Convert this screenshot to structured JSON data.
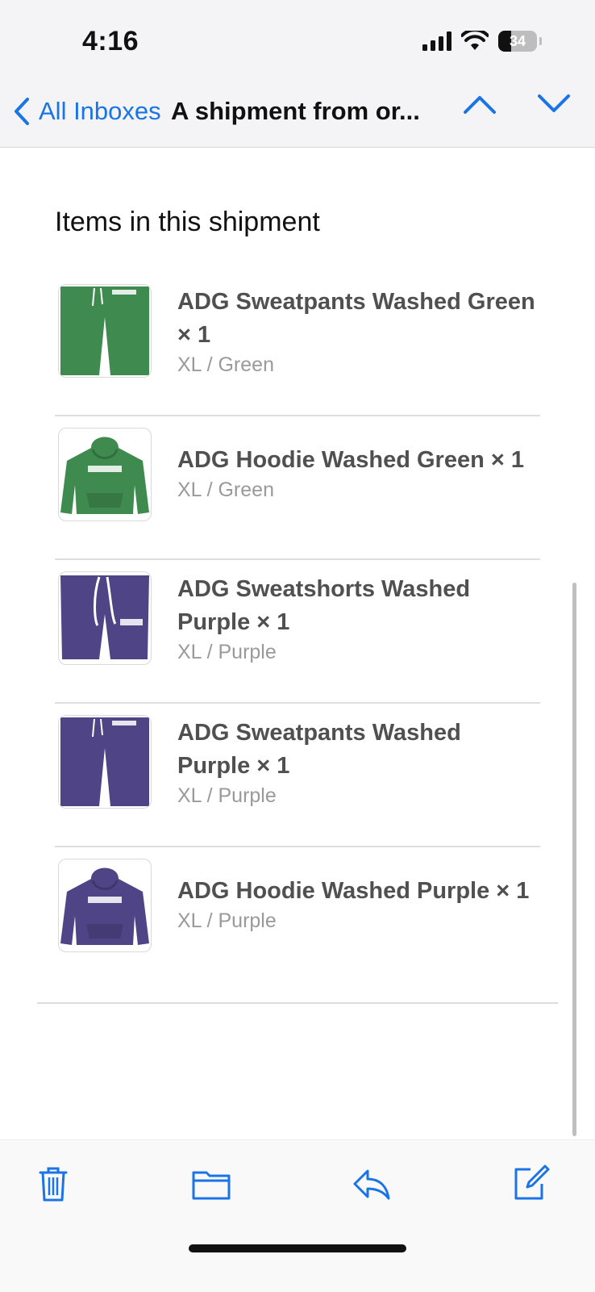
{
  "status": {
    "time": "4:16",
    "battery": "34",
    "battery_level": 0.34
  },
  "nav": {
    "back_label": "All Inboxes",
    "title": "A shipment from or..."
  },
  "section": {
    "title": "Items in this shipment"
  },
  "items": [
    {
      "name": "ADG Sweatpants Washed Green × 1",
      "variant": "XL / Green",
      "kind": "pants",
      "color": "#3f8a4e"
    },
    {
      "name": "ADG Hoodie Washed Green × 1",
      "variant": "XL / Green",
      "kind": "hoodie",
      "color": "#3f8a4e"
    },
    {
      "name": "ADG Sweatshorts Washed Purple × 1",
      "variant": "XL / Purple",
      "kind": "shorts",
      "color": "#4f4486"
    },
    {
      "name": "ADG Sweatpants Washed Purple × 1",
      "variant": "XL / Purple",
      "kind": "pants",
      "color": "#4f4486"
    },
    {
      "name": "ADG Hoodie Washed Purple × 1",
      "variant": "XL / Purple",
      "kind": "hoodie",
      "color": "#4f4486"
    }
  ],
  "toolbar": {
    "icons": [
      "trash-icon",
      "folder-icon",
      "reply-icon",
      "compose-icon"
    ]
  },
  "colors": {
    "accent": "#1a74e8",
    "text": "#505050",
    "muted": "#9a9a9a"
  }
}
